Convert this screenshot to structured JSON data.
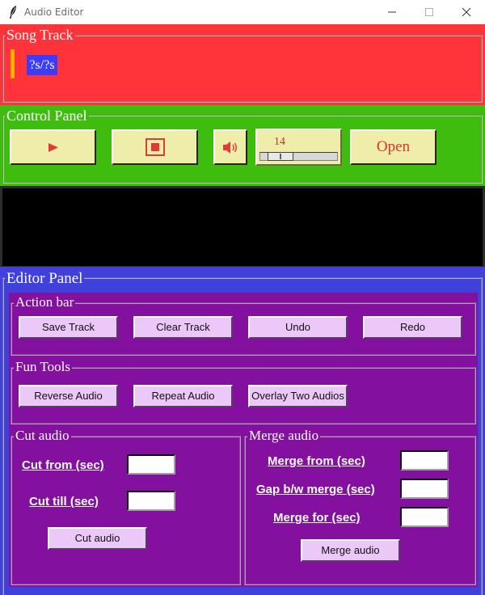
{
  "window": {
    "title": "Audio Editor",
    "controls": [
      "minimize-icon",
      "maximize-icon",
      "close-icon"
    ]
  },
  "song_track": {
    "title": "Song Track",
    "track_label": "?s/?s"
  },
  "control_panel": {
    "title": "Control Panel",
    "play_icon": "play-icon",
    "stop_icon": "stop-icon",
    "volume_icon": "speaker-icon",
    "volume_value": "14",
    "volume_level_fraction": 0.14,
    "open_label": "Open"
  },
  "editor_panel": {
    "title": "Editor Panel",
    "action_bar": {
      "title": "Action bar",
      "buttons": [
        "Save Track",
        "Clear Track",
        "Undo",
        "Redo"
      ]
    },
    "fun_tools": {
      "title": "Fun Tools",
      "buttons": [
        "Reverse Audio",
        "Repeat Audio",
        "Overlay Two Audios"
      ]
    },
    "cut_audio": {
      "title": "Cut audio",
      "from_label": "Cut from (sec)",
      "till_label": "Cut till (sec)",
      "from_value": "",
      "till_value": "",
      "button": "Cut audio"
    },
    "merge_audio": {
      "title": "Merge audio",
      "from_label": "Merge from (sec)",
      "gap_label": "Gap b/w merge (sec)",
      "for_label": "Merge for (sec)",
      "from_value": "",
      "gap_value": "",
      "for_value": "",
      "button": "Merge audio"
    }
  },
  "colors": {
    "song_track_bg": "#ff3339",
    "control_panel_bg": "#3ebd0f",
    "display_bg": "#000000",
    "editor_bg": "#4040dc",
    "sub_panel_bg": "#8410a0",
    "control_button_bg": "#eeeeaa",
    "editor_button_bg": "#ecc8f8",
    "track_marker": "#ffb000",
    "track_label_bg": "#3c3cff"
  }
}
